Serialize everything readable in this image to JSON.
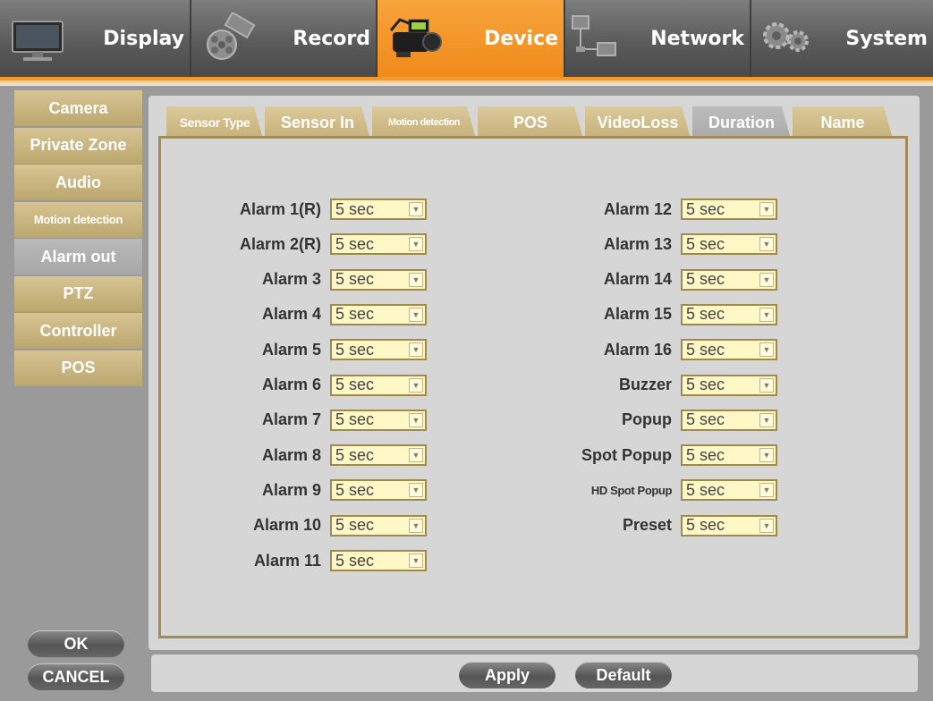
{
  "nav": {
    "tabs": [
      {
        "label": "Display",
        "icon": "monitor-icon"
      },
      {
        "label": "Record",
        "icon": "film-reel-icon"
      },
      {
        "label": "Device",
        "icon": "video-camera-icon"
      },
      {
        "label": "Network",
        "icon": "network-icon"
      },
      {
        "label": "System",
        "icon": "gears-icon"
      }
    ],
    "active": "Device"
  },
  "sidebar": {
    "items": [
      {
        "label": "Camera"
      },
      {
        "label": "Private Zone"
      },
      {
        "label": "Audio"
      },
      {
        "label": "Motion detection"
      },
      {
        "label": "Alarm out"
      },
      {
        "label": "PTZ"
      },
      {
        "label": "Controller"
      },
      {
        "label": "POS"
      }
    ],
    "active": "Alarm out"
  },
  "subtabs": {
    "items": [
      {
        "label": "Sensor Type"
      },
      {
        "label": "Sensor In"
      },
      {
        "label": "Motion detection"
      },
      {
        "label": "POS"
      },
      {
        "label": "VideoLoss"
      },
      {
        "label": "Duration"
      },
      {
        "label": "Name"
      }
    ],
    "active": "Duration"
  },
  "durations": {
    "left": [
      {
        "label": "Alarm 1(R)",
        "value": "5 sec"
      },
      {
        "label": "Alarm 2(R)",
        "value": "5 sec"
      },
      {
        "label": "Alarm 3",
        "value": "5 sec"
      },
      {
        "label": "Alarm 4",
        "value": "5 sec"
      },
      {
        "label": "Alarm 5",
        "value": "5 sec"
      },
      {
        "label": "Alarm 6",
        "value": "5 sec"
      },
      {
        "label": "Alarm 7",
        "value": "5 sec"
      },
      {
        "label": "Alarm 8",
        "value": "5 sec"
      },
      {
        "label": "Alarm 9",
        "value": "5 sec"
      },
      {
        "label": "Alarm 10",
        "value": "5 sec"
      },
      {
        "label": "Alarm 11",
        "value": "5 sec"
      }
    ],
    "right": [
      {
        "label": "Alarm 12",
        "value": "5 sec"
      },
      {
        "label": "Alarm 13",
        "value": "5 sec"
      },
      {
        "label": "Alarm 14",
        "value": "5 sec"
      },
      {
        "label": "Alarm 15",
        "value": "5 sec"
      },
      {
        "label": "Alarm 16",
        "value": "5 sec"
      },
      {
        "label": "Buzzer",
        "value": "5 sec"
      },
      {
        "label": "Popup",
        "value": "5 sec"
      },
      {
        "label": "Spot Popup",
        "value": "5 sec"
      },
      {
        "label": "HD Spot Popup",
        "value": "5 sec"
      },
      {
        "label": "Preset",
        "value": "5 sec"
      }
    ]
  },
  "buttons": {
    "ok": "OK",
    "cancel": "CANCEL",
    "apply": "Apply",
    "default": "Default"
  }
}
